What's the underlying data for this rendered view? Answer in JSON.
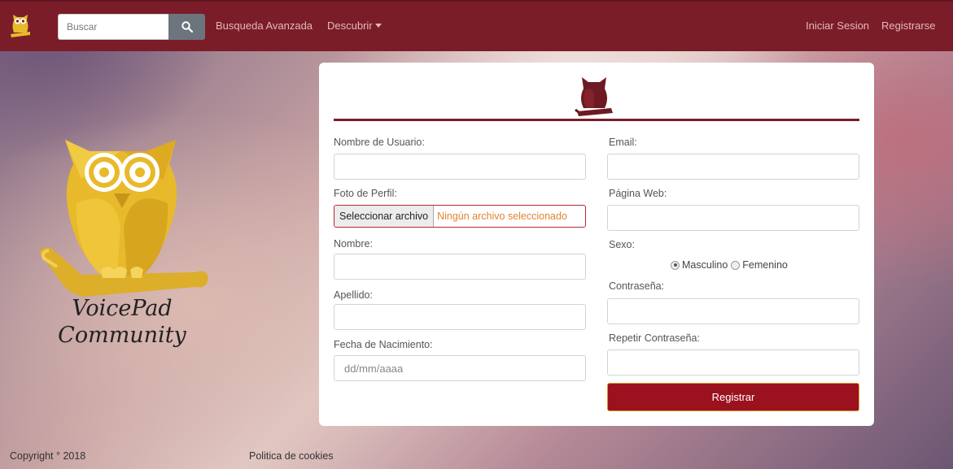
{
  "navbar": {
    "search_placeholder": "Buscar",
    "advanced_search": "Busqueda Avanzada",
    "discover": "Descubrir",
    "login": "Iniciar Sesion",
    "register": "Registrarse"
  },
  "brand": {
    "line1": "VoicePad",
    "line2": "Community"
  },
  "form": {
    "username_label": "Nombre de Usuario:",
    "photo_label": "Foto de Perfil:",
    "file_button": "Seleccionar archivo",
    "file_status": "Ningún archivo seleccionado",
    "name_label": "Nombre:",
    "surname_label": "Apellido:",
    "birthdate_label": "Fecha de Nacimiento:",
    "birthdate_placeholder": "dd/mm/aaaa",
    "email_label": "Email:",
    "website_label": "Página Web:",
    "sex_label": "Sexo:",
    "sex_options": [
      "Masculino",
      "Femenino"
    ],
    "sex_selected": "Masculino",
    "password_label": "Contraseña:",
    "repeat_password_label": "Repetir Contraseña:",
    "submit_label": "Registrar"
  },
  "footer": {
    "copyright": "Copyright ° 2018",
    "cookies": "Politica de cookies"
  },
  "colors": {
    "navbar": "#7a1d29",
    "submit": "#9b111e",
    "owl_gold": "#e8b92a",
    "owl_maroon": "#6e1a22"
  }
}
